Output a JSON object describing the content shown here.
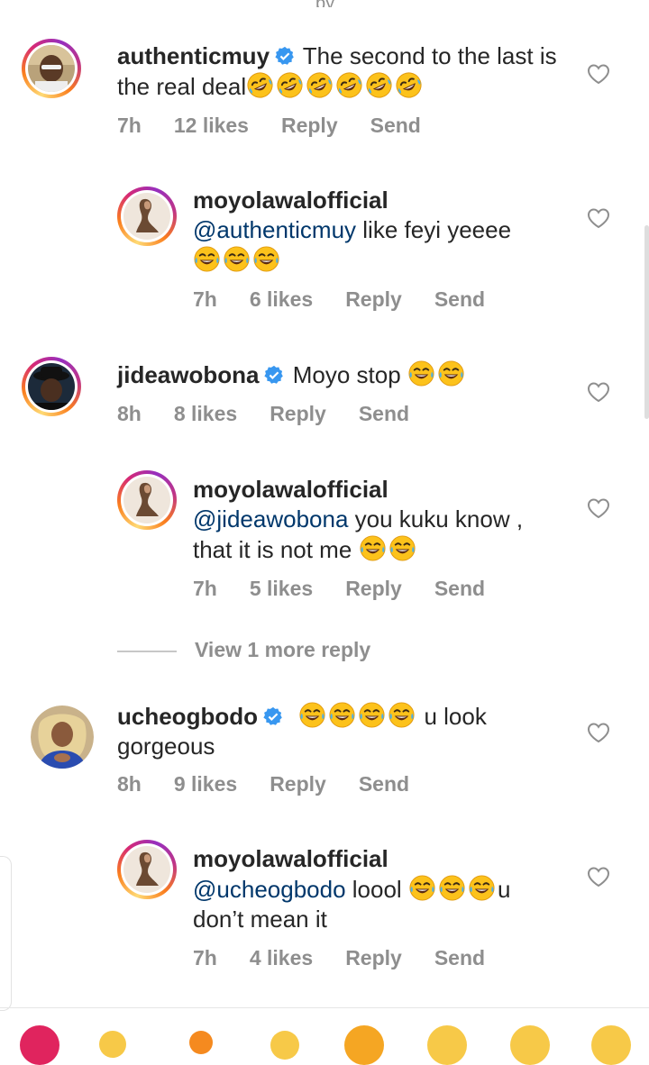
{
  "top_cut_text": "py",
  "comments": [
    {
      "username": "authenticmuy",
      "verified": true,
      "mention": "",
      "text": "The second to the last is the real deal",
      "emoji_count": 6,
      "emoji": "rofl",
      "time": "7h",
      "likes": "12 likes",
      "reply": "Reply",
      "send": "Send"
    },
    {
      "username": "moyolawalofficial",
      "verified": false,
      "mention": "@authenticmuy",
      "text": " like feyi yeeee",
      "emoji_count": 3,
      "emoji": "joy",
      "time": "7h",
      "likes": "6 likes",
      "reply": "Reply",
      "send": "Send"
    },
    {
      "username": "jideawobona",
      "verified": true,
      "mention": "",
      "text": "Moyo stop",
      "emoji_count": 2,
      "emoji": "joy",
      "time": "8h",
      "likes": "8 likes",
      "reply": "Reply",
      "send": "Send"
    },
    {
      "username": "moyolawalofficial",
      "verified": false,
      "mention": "@jideawobona",
      "text": " you kuku know , that it is not me",
      "emoji_count": 2,
      "emoji": "joy",
      "time": "7h",
      "likes": "5 likes",
      "reply": "Reply",
      "send": "Send"
    },
    {
      "username": "ucheogbodo",
      "verified": true,
      "mention": "",
      "text": "u look gorgeous",
      "emoji_count": 4,
      "emoji": "joy",
      "time": "8h",
      "likes": "9 likes",
      "reply": "Reply",
      "send": "Send"
    },
    {
      "username": "moyolawalofficial",
      "verified": false,
      "mention": "@ucheogbodo",
      "text": " loool",
      "text_after": "u don’t mean it",
      "emoji_count": 3,
      "emoji": "joy",
      "time": "7h",
      "likes": "4 likes",
      "reply": "Reply",
      "send": "Send"
    }
  ],
  "view_more": "View 1 more reply",
  "icons": {
    "like": "heart-outline-icon",
    "verified": "verified-badge-icon",
    "reactions": [
      "red-heart-emoji",
      "clap-emoji",
      "fire-emoji",
      "raised-hands-emoji",
      "crying-face-emoji",
      "heart-eyes-emoji",
      "open-mouth-emoji",
      "joy-emoji"
    ]
  },
  "colors": {
    "text": "#262626",
    "meta": "#8e8e8e",
    "mention": "#00376b",
    "verified": "#3897f0"
  }
}
